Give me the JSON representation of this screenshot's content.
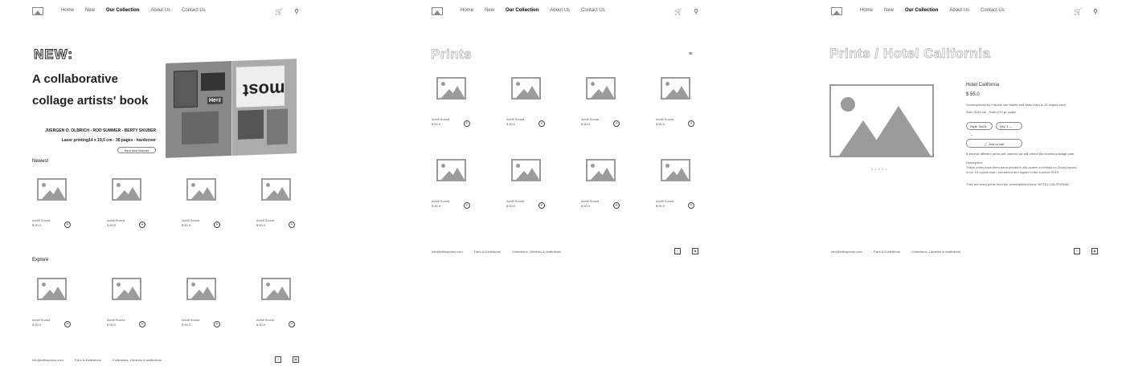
{
  "nav": {
    "links": [
      "Home",
      "New",
      "Our Collection",
      "About Us",
      "Contact Us"
    ],
    "active": "Our Collection",
    "cart_icon": "cart-icon",
    "search_icon": "search-icon"
  },
  "home": {
    "hero": {
      "label": "NEW:",
      "title_line1": "A collaborative",
      "title_line2": "collage artists' book",
      "authors": "JUERGEN O. OLBRICH - ROD SUMMER - BERTY SKUBER",
      "spec": "Laser printing14 x 19,5 cm - 36 pages - hardcover",
      "button": "Have New Artworks",
      "book_text_big": "most",
      "book_text_herz": "Herz"
    },
    "newest_title": "Newest",
    "explore_title": "Explore"
  },
  "product": {
    "name": "Achill Sound",
    "price": "$ 50.0"
  },
  "prints": {
    "title": "Prints",
    "filter_icon": "filter-icon"
  },
  "detail": {
    "breadcrumb": "Prints / Hotel California",
    "name": "Hotel California",
    "price": "$ 55.0",
    "line1": "Screenprinted by Francis Van Maele and Antic-Ham in 15 copies each",
    "line2": "Size: 5x29 cm - Satin 170 gr. paper",
    "style_select": "Style: No01",
    "qty_select": "Qty: 1",
    "add_to_cart": "Add to cart",
    "note": "If several different prints are ordered we will refund the excess postage paid",
    "desc_label": "Description:",
    "desc1": "These prints have been hand printed in silk-screen in Ireland on Zuhal Insized",
    "desc2": "in ca. 15 copies each, numbered and signed in the summer 2019.",
    "desc3": "They are extra prints from the screenprinted book 'HOTEL CALIFORNIA'.",
    "dots": "• • • • •"
  },
  "footer": {
    "email": "info@edfospress.com",
    "fairs": "Fairs & Exhibitions",
    "collections": "Collections, Libraries & Institutions",
    "icon1": "facebook-icon",
    "icon2": "instagram-icon"
  }
}
